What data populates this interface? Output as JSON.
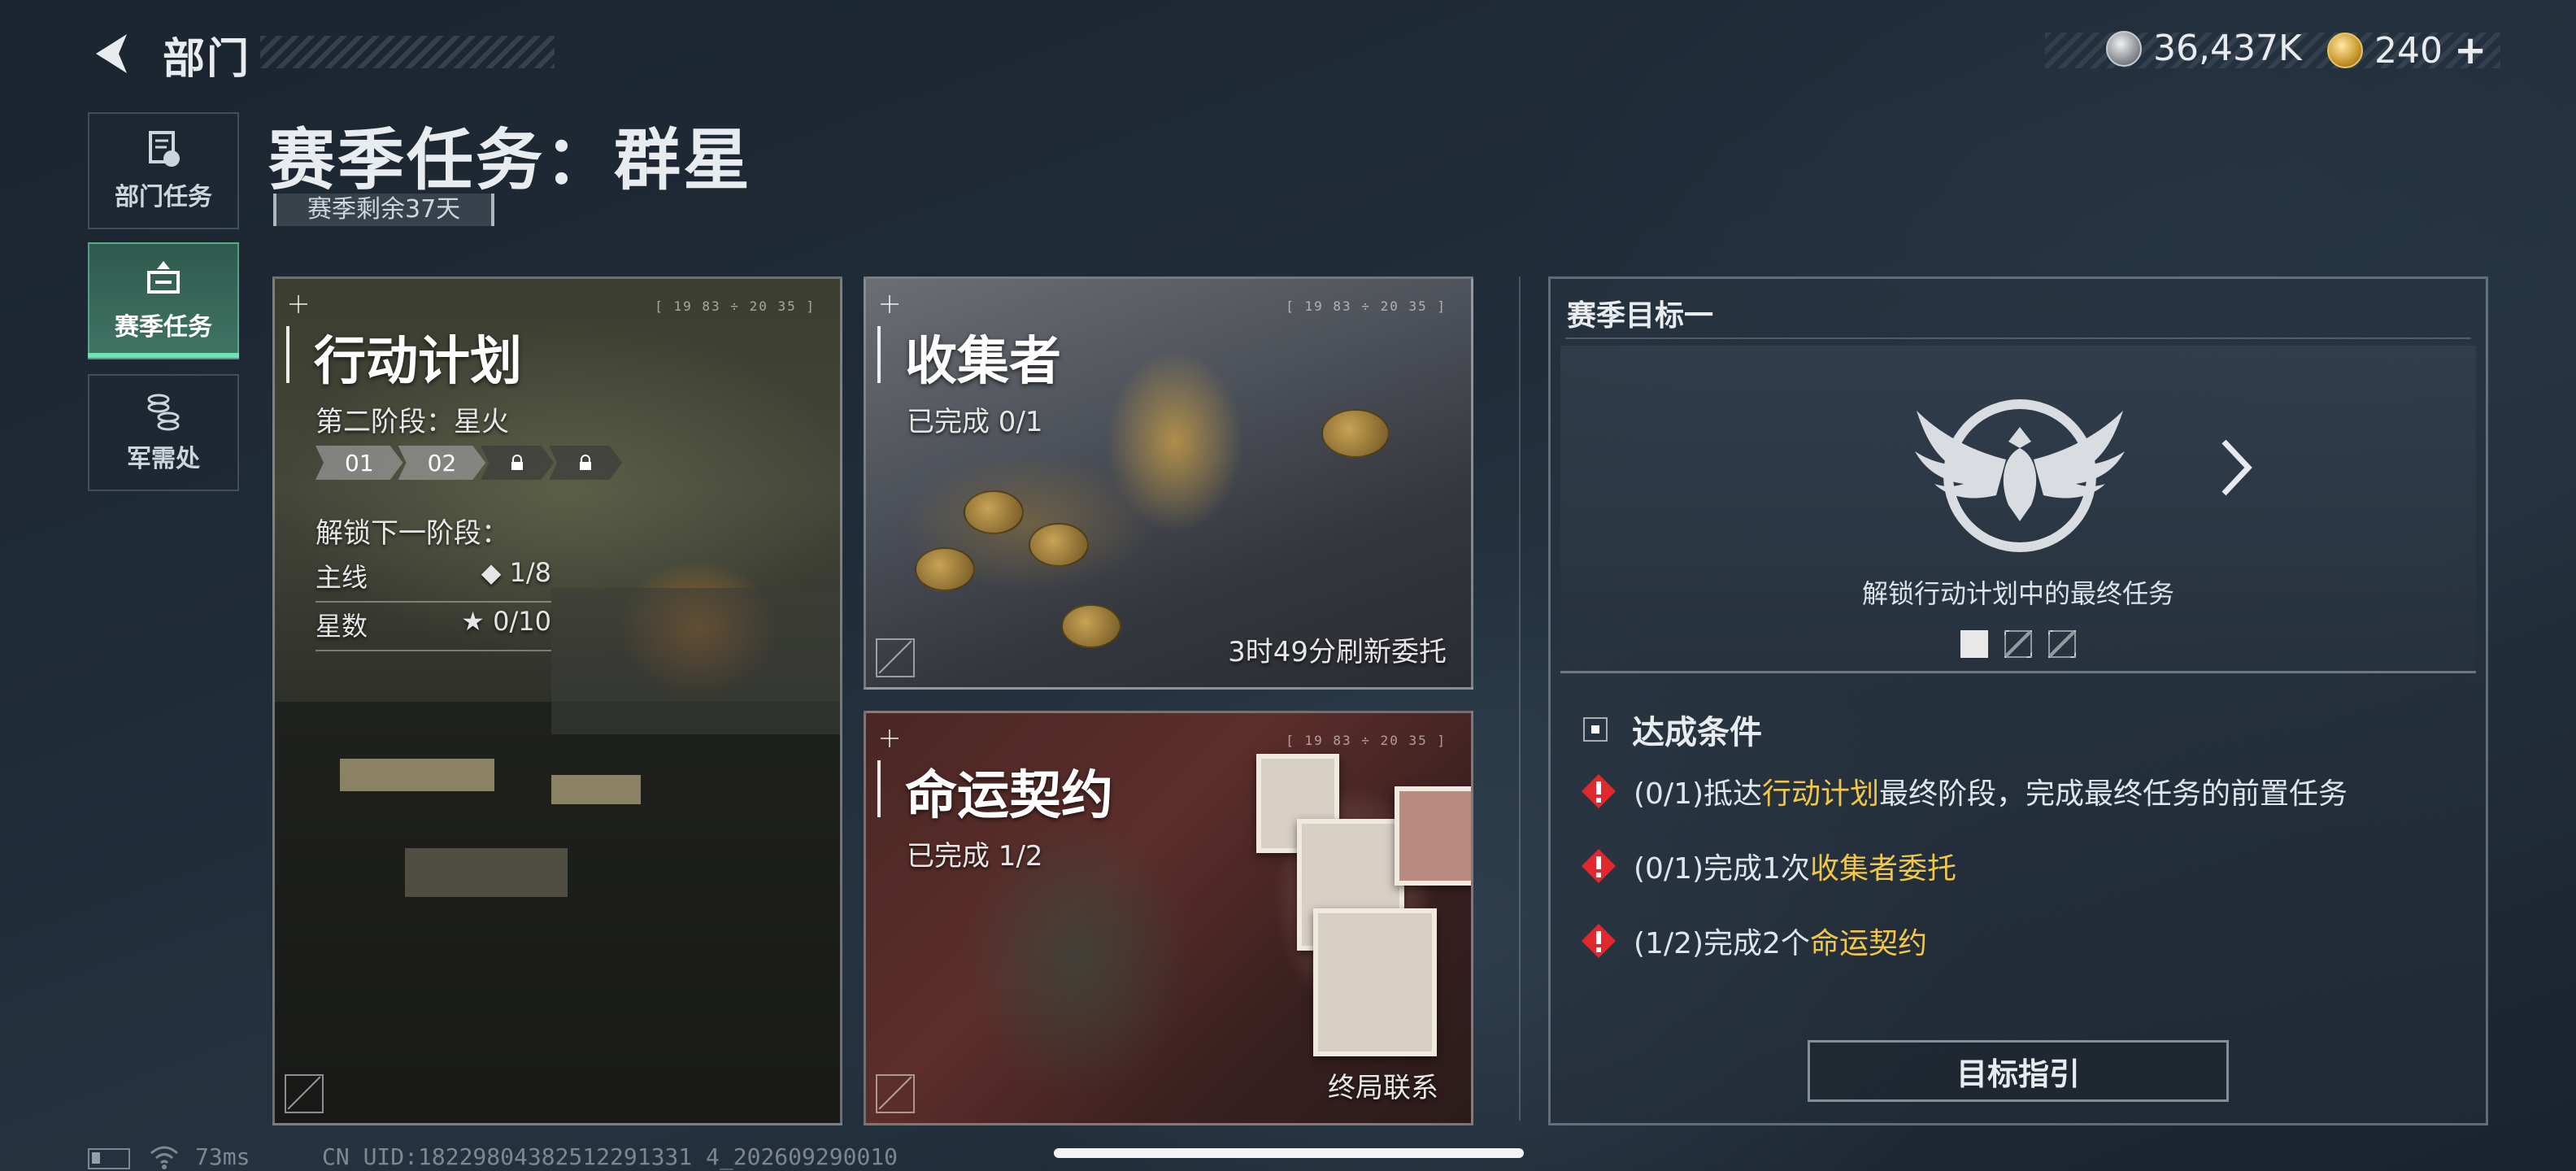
{
  "header": {
    "back_label": "部门",
    "currency": [
      {
        "icon": "silver-coin-icon",
        "value": "36,437K"
      },
      {
        "icon": "gold-coin-icon",
        "value": "240"
      }
    ]
  },
  "sidebar": {
    "items": [
      {
        "label": "部门任务",
        "icon": "department-task-icon",
        "active": false
      },
      {
        "label": "赛季任务",
        "icon": "season-task-icon",
        "active": true
      },
      {
        "label": "军需处",
        "icon": "supply-icon",
        "active": false
      }
    ]
  },
  "page": {
    "title": "赛季任务：群星",
    "remaining": "赛季剩余37天"
  },
  "cards": {
    "plan": {
      "title": "行动计划",
      "stage": "第二阶段：星火",
      "stages": [
        "01",
        "02"
      ],
      "unlock_label": "解锁下一阶段：",
      "rows": [
        {
          "label": "主线",
          "value": "◆ 1/8"
        },
        {
          "label": "星数",
          "value": "★ 0/10"
        }
      ],
      "code": "[ 19 83 ÷ 20 35 ]"
    },
    "collector": {
      "title": "收集者",
      "progress": "已完成 0/1",
      "refresh": "3时49分刷新委托",
      "code": "[ 19 83 ÷ 20 35 ]"
    },
    "fate": {
      "title": "命运契约",
      "progress": "已完成 1/2",
      "footer": "终局联系",
      "code": "[ 19 83 ÷ 20 35 ]"
    }
  },
  "goal": {
    "title": "赛季目标一",
    "caption": "解锁行动计划中的最终任务",
    "conditions_title": "达成条件",
    "conditions": [
      {
        "prefix": "(0/1)抵达",
        "highlight": "行动计划",
        "suffix": "最终阶段，完成最终任务的前置任务"
      },
      {
        "prefix": "(0/1)完成1次",
        "highlight": "收集者委托",
        "suffix": ""
      },
      {
        "prefix": "(1/2)完成2个",
        "highlight": "命运契约",
        "suffix": ""
      }
    ],
    "button": "目标指引",
    "colors": {
      "highlight": "#f1c64a",
      "warning": "#e0282e"
    }
  },
  "footer": {
    "ping": "73ms",
    "uid": "CN UID:18229804382512291331 4_202609290010"
  }
}
